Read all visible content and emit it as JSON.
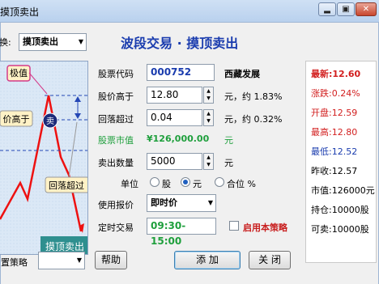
{
  "window": {
    "title": "摸顶卖出",
    "buttons": [
      "▂",
      "▣",
      "✕"
    ]
  },
  "header": {
    "switch_label": "换:",
    "strategy_select": "摸顶卖出",
    "big_title": "波段交易 · 摸顶卖出"
  },
  "chart": {
    "label_top": "极值",
    "label_price_above": "价高于",
    "label_fallback": "回落超过",
    "sell_badge": "卖",
    "footer_label": "摸顶卖出"
  },
  "form": {
    "code_label": "股票代码",
    "code_value": "000752",
    "stock_name": "西藏发展",
    "price_label": "股价高于",
    "price_value": "12.80",
    "price_unit": "元，约 1.83%",
    "fall_label": "回落超过",
    "fall_value": "0.04",
    "fall_unit": "元，约 0.32%",
    "market_value_label": "股票市值",
    "market_value": "¥126,000.00",
    "market_value_unit": "元",
    "sell_qty_label": "卖出数量",
    "sell_qty_value": "5000",
    "sell_qty_unit": "元",
    "unit_label": "单位",
    "unit_options": [
      "股",
      "元",
      "合位 %"
    ],
    "unit_selected": "元",
    "quote_label": "使用报价",
    "quote_value": "即时价",
    "timer_label": "定时交易",
    "timer_value": "09:30-15:00",
    "enable_label": "启用本策略"
  },
  "info": {
    "latest": "最新:12.60",
    "change": "涨跌:0.24%",
    "open": "开盘:12.59",
    "high": "最高:12.80",
    "low": "最低:12.52",
    "prev_close": "昨收:12.57",
    "market_value": "市值:126000元",
    "holding": "持仓:10000股",
    "sellable": "可卖:10000股"
  },
  "footer": {
    "strategy_label": "置策略",
    "help_label": "帮助",
    "add_label": "添 加",
    "close_label": "关 闭"
  }
}
